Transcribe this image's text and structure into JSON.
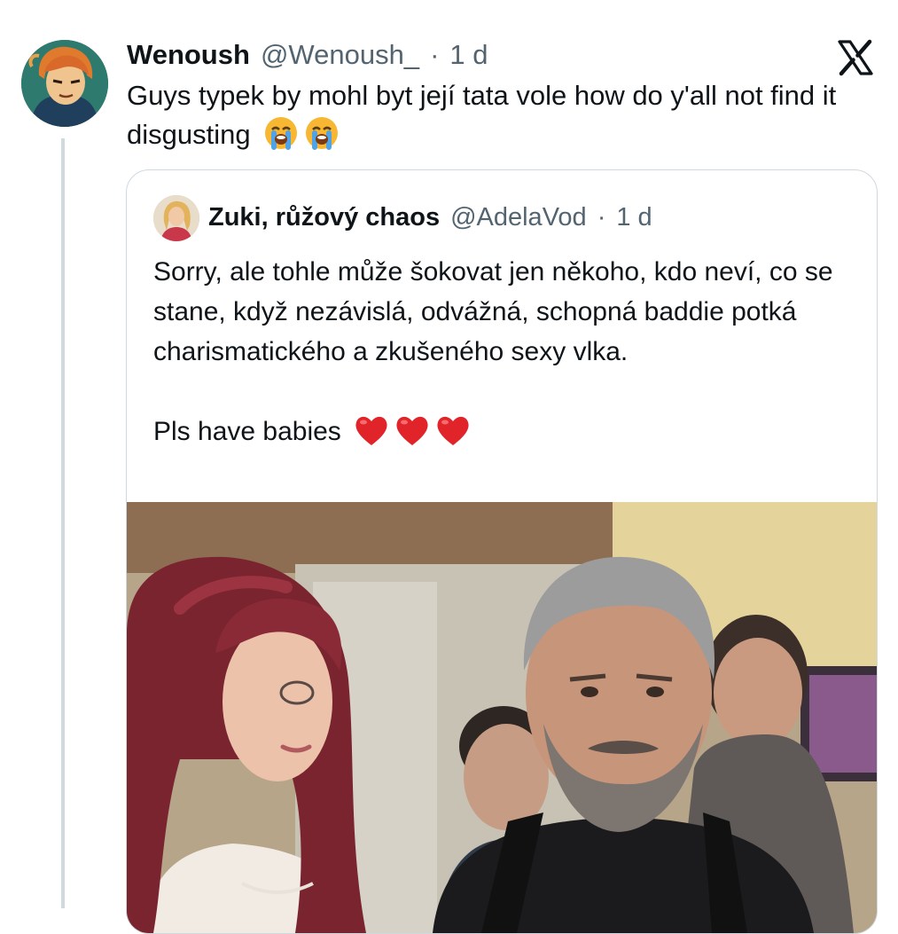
{
  "tweet": {
    "author_name": "Wenoush",
    "author_handle": "@Wenoush_",
    "separator": "·",
    "time": "1 d",
    "text": "Guys typek by mohl byt její tata vole how do y'all not find it disgusting"
  },
  "quote": {
    "author_name": "Zuki, růžový chaos",
    "author_handle": "@AdelaVod",
    "separator": "·",
    "time": "1 d",
    "paragraph_1": "Sorry, ale tohle může šokovat jen někoho, kdo neví, co se stane, když nezávislá, odvážná, schopná baddie potká charismatického a zkušeného sexy vlka.",
    "paragraph_2": "Pls have babies"
  },
  "icons": {
    "platform_logo": "x-logo-icon",
    "tweet_emoji": "loudly-crying-face-icon",
    "quote_emoji": "red-heart-icon"
  },
  "colors": {
    "text_primary": "#0f1419",
    "text_secondary": "#536471",
    "border": "#cfd9de",
    "heart": "#e0242a",
    "crying_face": "#f7b733",
    "tears": "#4fa3e6"
  }
}
